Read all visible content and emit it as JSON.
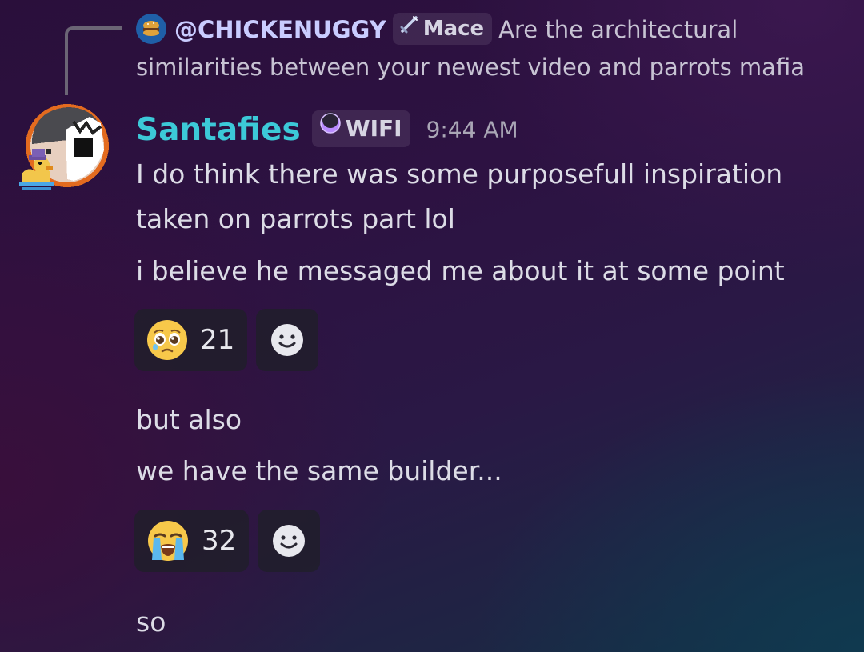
{
  "reply": {
    "mention": "@CHICKENUGGY",
    "tag_label": "Mace",
    "tag_icon": "sword-icon",
    "text": "Are the architectural similarities between your newest video and parrots mafia"
  },
  "author": {
    "name": "Santafies",
    "tag_label": "WIFI",
    "tag_icon": "crescent-moon-icon",
    "timestamp": "9:44 AM",
    "name_color": "#3cc9d8"
  },
  "messages": [
    {
      "line1": "I do think there was some purposefull inspiration",
      "line2": "taken on parrots part lol"
    },
    {
      "text": "i believe he messaged me about it at some point"
    },
    {
      "text": "but also"
    },
    {
      "text": "we have the same builder..."
    },
    {
      "text": "so"
    }
  ],
  "reactions": [
    {
      "emoji": "pleading-face-emoji",
      "count": "21"
    },
    {
      "emoji": "loudly-crying-face-emoji",
      "count": "32"
    }
  ]
}
